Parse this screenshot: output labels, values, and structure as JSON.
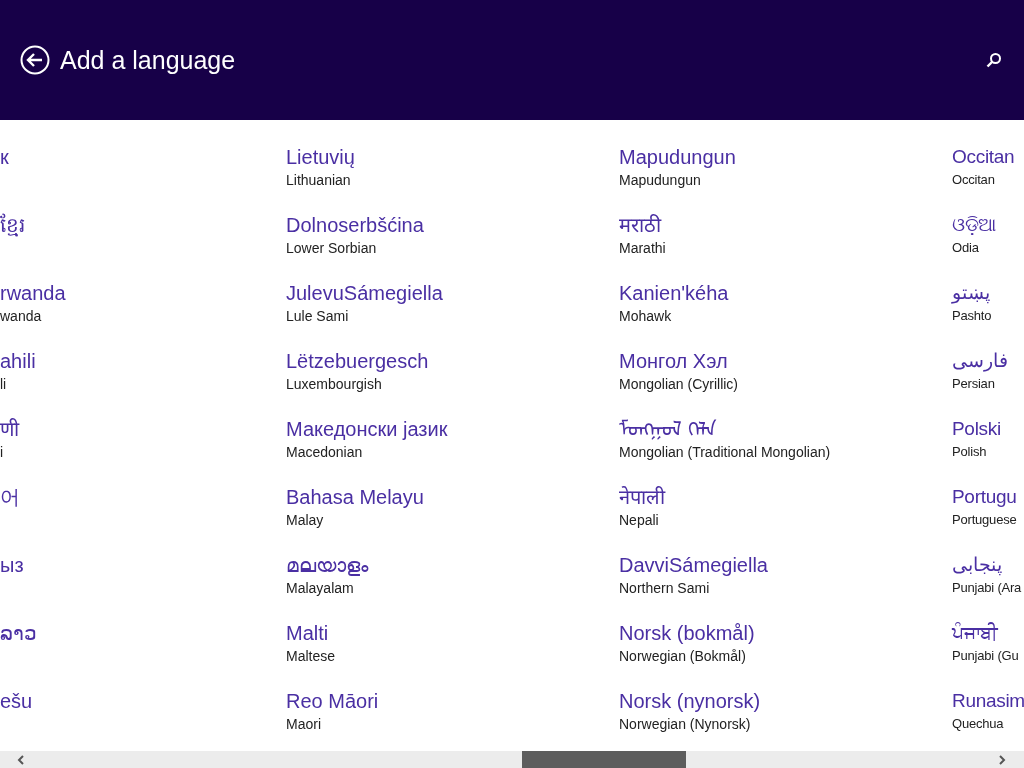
{
  "header": {
    "title": "Add a language"
  },
  "columns": [
    {
      "items": [
        {
          "native": "к"
        },
        {
          "native": "ខ្មែរ"
        },
        {
          "native": "rwanda",
          "english": "wanda"
        },
        {
          "native": "ahili",
          "english": "li"
        },
        {
          "native": "णी",
          "english": "i"
        },
        {
          "native": "어"
        },
        {
          "native": "ыз"
        },
        {
          "native": "ລາວ"
        },
        {
          "native": "ešu"
        }
      ]
    },
    {
      "items": [
        {
          "native": "Lietuvių",
          "english": "Lithuanian"
        },
        {
          "native": "Dolnoserbšćina",
          "english": "Lower Sorbian"
        },
        {
          "native": "JulevuSámegiella",
          "english": "Lule Sami"
        },
        {
          "native": "Lëtzebuergesch",
          "english": "Luxembourgish"
        },
        {
          "native": "Македонски јазик",
          "english": "Macedonian"
        },
        {
          "native": "Bahasa Melayu",
          "english": "Malay"
        },
        {
          "native": "മലയാളം",
          "english": "Malayalam"
        },
        {
          "native": "Malti",
          "english": "Maltese"
        },
        {
          "native": "Reo Māori",
          "english": "Maori"
        }
      ]
    },
    {
      "items": [
        {
          "native": "Mapudungun",
          "english": "Mapudungun"
        },
        {
          "native": "मराठी",
          "english": "Marathi"
        },
        {
          "native": "Kanien'kéha",
          "english": "Mohawk"
        },
        {
          "native": "Монгол Хэл",
          "english": "Mongolian (Cyrillic)"
        },
        {
          "native": "ᠮᠣᠩᠭᠣᠯ ᠬᠡᠯᠡ",
          "english": "Mongolian (Traditional Mongolian)"
        },
        {
          "native": "नेपाली",
          "english": "Nepali"
        },
        {
          "native": "DavviSámegiella",
          "english": "Northern Sami"
        },
        {
          "native": "Norsk (bokmål)",
          "english": "Norwegian (Bokmål)"
        },
        {
          "native": "Norsk (nynorsk)",
          "english": "Norwegian (Nynorsk)"
        }
      ]
    },
    {
      "items": [
        {
          "native": "Occitan",
          "english": "Occitan"
        },
        {
          "native": "ଓଡ଼ିଆ",
          "english": "Odia"
        },
        {
          "native": "پښتو",
          "english": "Pashto"
        },
        {
          "native": "فارسی",
          "english": "Persian"
        },
        {
          "native": "Polski",
          "english": "Polish"
        },
        {
          "native": "Portugu",
          "english": "Portuguese"
        },
        {
          "native": "پنجابی",
          "english": "Punjabi (Ara"
        },
        {
          "native": "ਪੰਜਾਬੀ",
          "english": "Punjabi (Gu"
        },
        {
          "native": "Runasim",
          "english": "Quechua"
        }
      ]
    }
  ]
}
